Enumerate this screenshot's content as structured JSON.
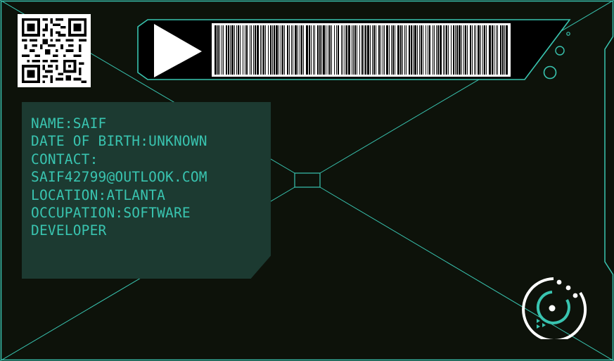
{
  "card": {
    "qr_code_icon": "qr-code",
    "play_icon": "play-triangle-icon",
    "barcode_icon": "barcode",
    "logo_icon": "target-circle-logo",
    "colors": {
      "background": "#0d120a",
      "accent": "#39c4b0",
      "panel": "#1c3a31",
      "banner": "#000000",
      "white": "#ffffff"
    }
  },
  "profile": {
    "name": "NAME:SAIF",
    "dob": "DATE OF BIRTH:UNKNOWN",
    "contact_label": "CONTACT:",
    "contact_email": "SAIF42799@OUTLOOK.COM",
    "location": "LOCATION:ATLANTA",
    "occupation_1": "OCCUPATION:SOFTWARE",
    "occupation_2": "DEVELOPER"
  }
}
